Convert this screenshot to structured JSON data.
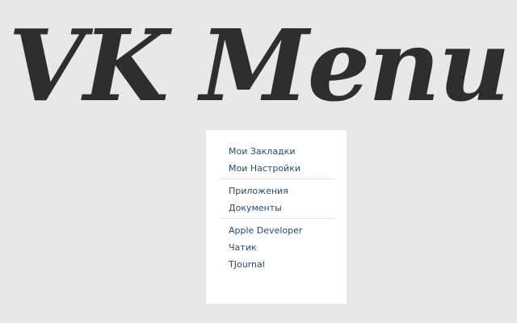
{
  "title": "VK Menu",
  "colors": {
    "background": "#e8e8e8",
    "title": "#2e2e2e",
    "panel": "#ffffff",
    "link": "#2b4a6b",
    "divider": "#e2e6ea"
  },
  "menu": {
    "groups": [
      {
        "items": [
          {
            "label": "Мои Закладки"
          },
          {
            "label": "Мои Настройки"
          }
        ]
      },
      {
        "items": [
          {
            "label": "Приложения"
          },
          {
            "label": "Документы"
          }
        ]
      },
      {
        "items": [
          {
            "label": "Apple Developer"
          },
          {
            "label": "Чатик"
          },
          {
            "label": "TJournal"
          }
        ]
      }
    ]
  }
}
